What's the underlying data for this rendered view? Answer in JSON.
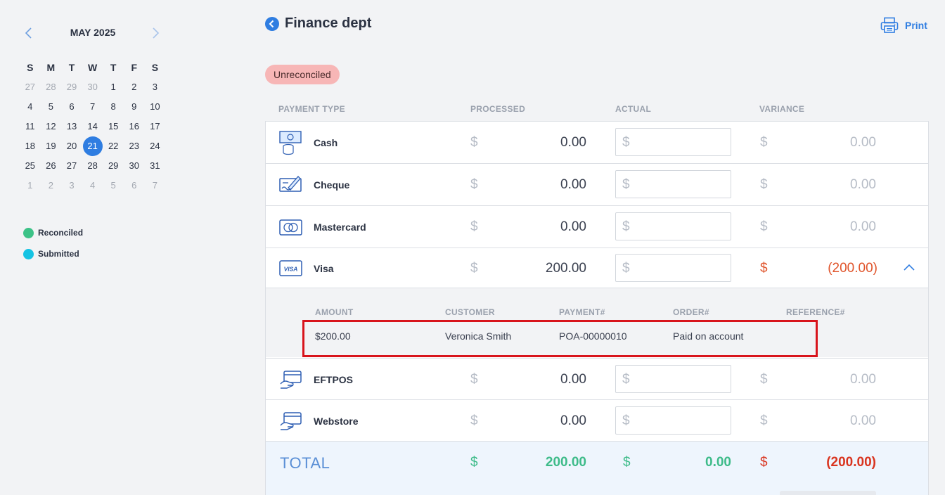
{
  "calendar": {
    "month_label": "MAY 2025",
    "days_of_week": [
      "S",
      "M",
      "T",
      "W",
      "T",
      "F",
      "S"
    ],
    "weeks": [
      [
        "27",
        "28",
        "29",
        "30",
        "1",
        "2",
        "3"
      ],
      [
        "4",
        "5",
        "6",
        "7",
        "8",
        "9",
        "10"
      ],
      [
        "11",
        "12",
        "13",
        "14",
        "15",
        "16",
        "17"
      ],
      [
        "18",
        "19",
        "20",
        "21",
        "22",
        "23",
        "24"
      ],
      [
        "25",
        "26",
        "27",
        "28",
        "29",
        "30",
        "31"
      ],
      [
        "1",
        "2",
        "3",
        "4",
        "5",
        "6",
        "7"
      ]
    ],
    "selected_day": "21",
    "accent_color": "#2f7de1"
  },
  "legend": [
    {
      "label": "Reconciled",
      "color": "#3cc287"
    },
    {
      "label": "Submitted",
      "color": "#15c3e3"
    }
  ],
  "header": {
    "title": "Finance dept",
    "print_label": "Print",
    "status_badge": "Unreconciled"
  },
  "columns": {
    "payment_type": "PAYMENT TYPE",
    "processed": "PROCESSED",
    "actual": "ACTUAL",
    "variance": "VARIANCE"
  },
  "currency_symbol": "$",
  "payments": [
    {
      "name": "Cash",
      "icon": "cash-icon",
      "processed": "0.00",
      "actual": "",
      "variance": "0.00",
      "negative": false
    },
    {
      "name": "Cheque",
      "icon": "cheque-icon",
      "processed": "0.00",
      "actual": "",
      "variance": "0.00",
      "negative": false
    },
    {
      "name": "Mastercard",
      "icon": "mastercard-icon",
      "processed": "0.00",
      "actual": "",
      "variance": "0.00",
      "negative": false
    },
    {
      "name": "Visa",
      "icon": "visa-icon",
      "processed": "200.00",
      "actual": "",
      "variance": "(200.00)",
      "negative": true,
      "expanded": true
    },
    {
      "name": "EFTPOS",
      "icon": "eftpos-icon",
      "processed": "0.00",
      "actual": "",
      "variance": "0.00",
      "negative": false
    },
    {
      "name": "Webstore",
      "icon": "webstore-icon",
      "processed": "0.00",
      "actual": "",
      "variance": "0.00",
      "negative": false
    }
  ],
  "visa_icon_text": "VISA",
  "detail": {
    "headers": {
      "amount": "AMOUNT",
      "customer": "CUSTOMER",
      "payment": "PAYMENT#",
      "order": "ORDER#",
      "reference": "REFERENCE#"
    },
    "row": {
      "amount": "$200.00",
      "customer": "Veronica Smith",
      "payment": "POA-00000010",
      "order": "Paid on account",
      "reference": ""
    }
  },
  "total": {
    "label": "TOTAL",
    "processed": "200.00",
    "actual": "0.00",
    "variance": "(200.00)"
  }
}
